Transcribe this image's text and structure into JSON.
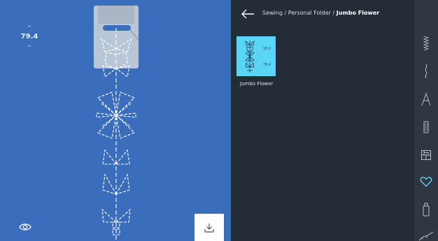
{
  "canvas": {
    "stitch_length": "79.4",
    "length_up_icon": "chevron-up-icon",
    "length_down_icon": "chevron-down-icon",
    "eye_icon": "eye-icon",
    "import_icon": "download-tray-icon"
  },
  "header": {
    "back_icon": "arrow-left-icon",
    "breadcrumb_path": "Sewing / Personal Folder / ",
    "breadcrumb_current": "Jumbo Flower"
  },
  "tiles": [
    {
      "name": "Jumbo Flower",
      "value1": "18.0",
      "value2": "79.4",
      "color": "#5ad5f5"
    }
  ],
  "sidebar": {
    "items": [
      {
        "icon": "utility-stitches-icon",
        "active": false
      },
      {
        "icon": "decorative-stitches-icon",
        "active": false
      },
      {
        "icon": "alphabets-icon",
        "active": false
      },
      {
        "icon": "buttonholes-icon",
        "active": false
      },
      {
        "icon": "quilt-stitches-icon",
        "active": false
      },
      {
        "icon": "personal-folder-heart-icon",
        "active": true
      },
      {
        "icon": "memory-icon",
        "active": false
      },
      {
        "icon": "tapering-icon",
        "active": false
      }
    ]
  },
  "colors": {
    "canvas": "#3a6dbb",
    "panel": "#242c37",
    "accent": "#5ad5f5"
  }
}
